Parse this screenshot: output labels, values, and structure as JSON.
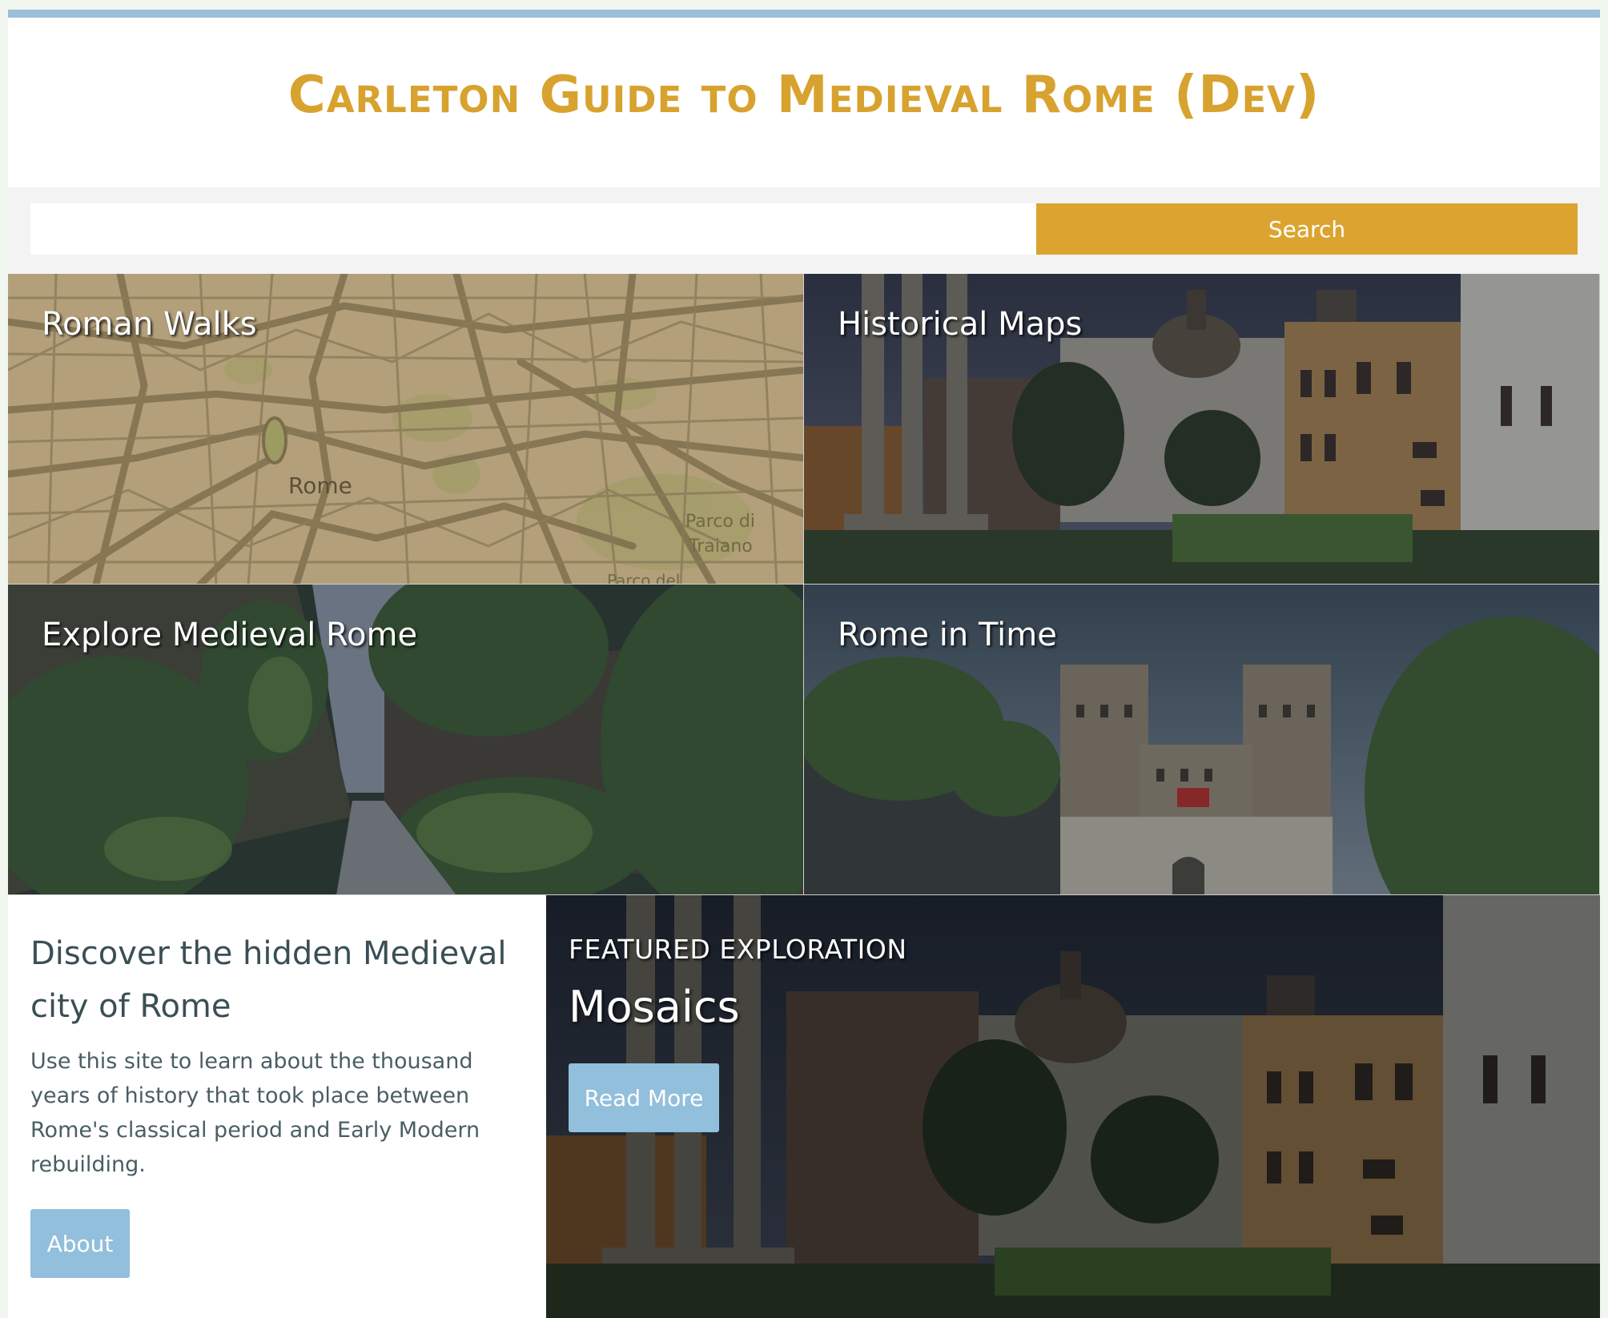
{
  "site": {
    "title": "Carleton Guide to Medieval Rome (Dev)"
  },
  "search": {
    "value": "",
    "placeholder": "",
    "button_label": "Search"
  },
  "tiles": [
    {
      "label": "Roman Walks",
      "map_labels": [
        "Rome",
        "Parco di",
        "Traiano",
        "Parco del"
      ]
    },
    {
      "label": "Historical Maps"
    },
    {
      "label": "Explore Medieval Rome"
    },
    {
      "label": "Rome in Time"
    }
  ],
  "intro": {
    "heading": "Discover the hidden Medieval city of Rome",
    "text": "Use this site to learn about the thousand years of history that took place between Rome's classical period and Early Modern rebuilding.",
    "button_label": "About"
  },
  "featured": {
    "kicker": "FEATURED EXPLORATION",
    "title": "Mosaics",
    "button_label": "Read More"
  },
  "colors": {
    "accent_gold": "#dba430",
    "accent_blue": "#92bfdb",
    "top_bar": "#9bbfd9",
    "text_dark": "#3a4f55"
  }
}
